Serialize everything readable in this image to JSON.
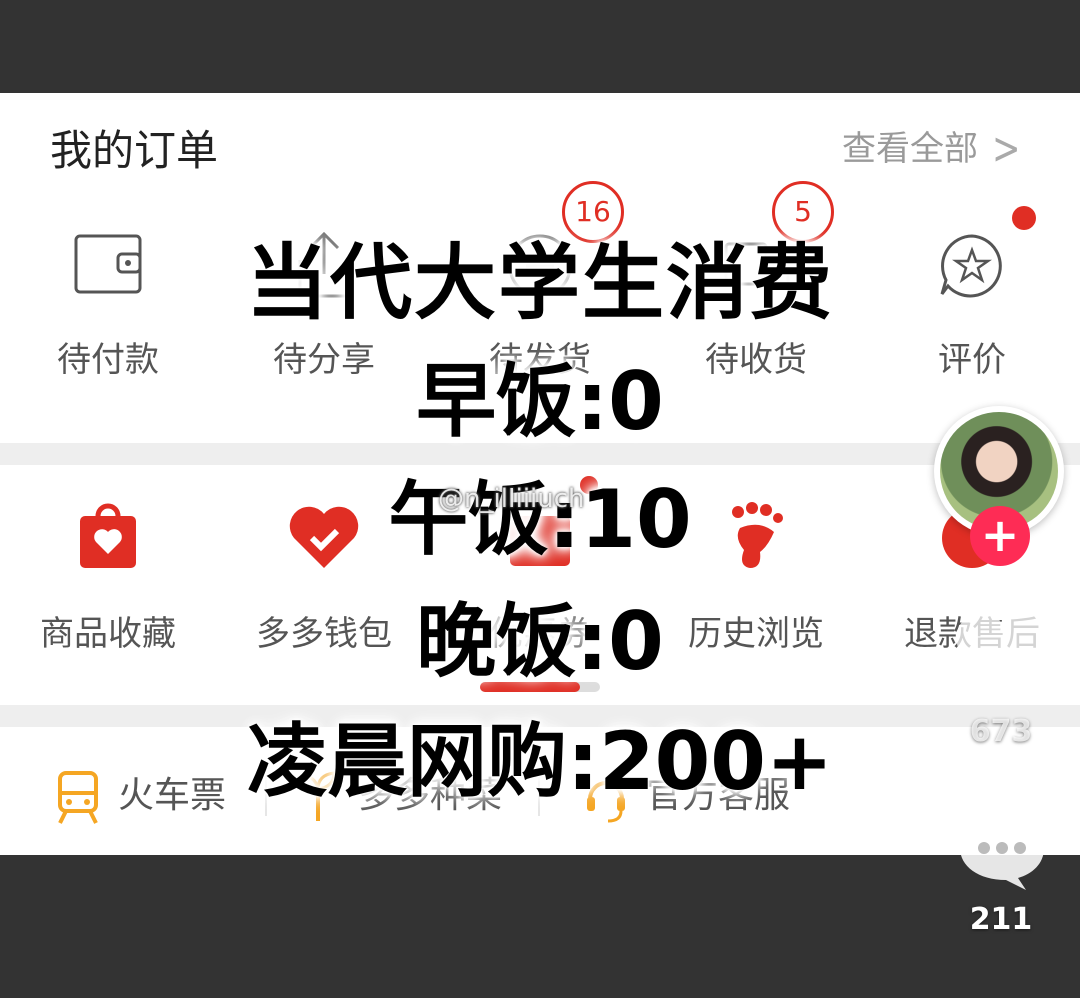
{
  "orders": {
    "title": "我的订单",
    "view_all": "查看全部",
    "items": [
      {
        "label": "待付款",
        "icon": "wallet-icon"
      },
      {
        "label": "待分享",
        "icon": "share-icon"
      },
      {
        "label": "待发货",
        "icon": "box-icon",
        "badge": "16"
      },
      {
        "label": "待收货",
        "icon": "truck-icon",
        "badge": "5"
      },
      {
        "label": "评价",
        "icon": "star-comment-icon"
      }
    ]
  },
  "services": [
    {
      "label": "商品收藏",
      "icon": "favorite-bag-icon"
    },
    {
      "label": "多多钱包",
      "icon": "heart-wallet-icon"
    },
    {
      "label": "优惠券",
      "icon": "coupon-icon"
    },
    {
      "label": "历史浏览",
      "icon": "footprint-icon"
    },
    {
      "label": "退款售后",
      "icon": "refund-icon"
    }
  ],
  "tools": [
    {
      "label": "火车票",
      "icon": "train-icon"
    },
    {
      "label": "多多种菜",
      "icon": "plant-icon"
    },
    {
      "label": "官方客服",
      "icon": "headset-icon"
    }
  ],
  "caption": {
    "title": "当代大学生消费",
    "lines": [
      "早饭:0",
      "午饭:10",
      "晚饭:0",
      "凌晨网购:200+"
    ]
  },
  "watermark": "@n_ilIiiiuch",
  "side": {
    "likes": "673",
    "comments": "211"
  },
  "colors": {
    "accent": "#e02e24",
    "follow": "#fe2c55",
    "tool_orange": "#f5a623"
  }
}
